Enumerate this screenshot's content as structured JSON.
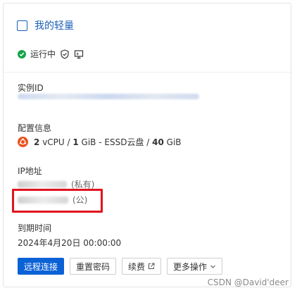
{
  "card": {
    "title": "我的轻量",
    "status": "运行中",
    "instance_id_label": "实例ID",
    "config_label": "配置信息",
    "spec": {
      "cpu": "2",
      "cpu_unit": "vCPU",
      "mem": "1",
      "mem_unit": "GiB",
      "disk_type": "ESSD云盘",
      "disk": "40",
      "disk_unit": "GiB"
    },
    "ip_label": "IP地址",
    "ip_private_suffix": "(私有)",
    "ip_public_suffix": "(公)",
    "expire_label": "到期时间",
    "expire_value": "2024年4月20日 00:00:00"
  },
  "actions": {
    "remote_connect": "远程连接",
    "reset_password": "重置密码",
    "renew": "续费",
    "more_actions": "更多操作"
  },
  "watermark": "CSDN @David'deer",
  "colors": {
    "accent": "#0b62d6",
    "title_blue": "#1a5fb4",
    "status_green": "#15a34a",
    "highlight_red": "#e0141e",
    "ubuntu_orange": "#e95420"
  },
  "icons": [
    "check-circle-icon",
    "shield-check-icon",
    "monitor-icon",
    "ubuntu-icon",
    "external-link-icon",
    "chevron-down-icon"
  ]
}
